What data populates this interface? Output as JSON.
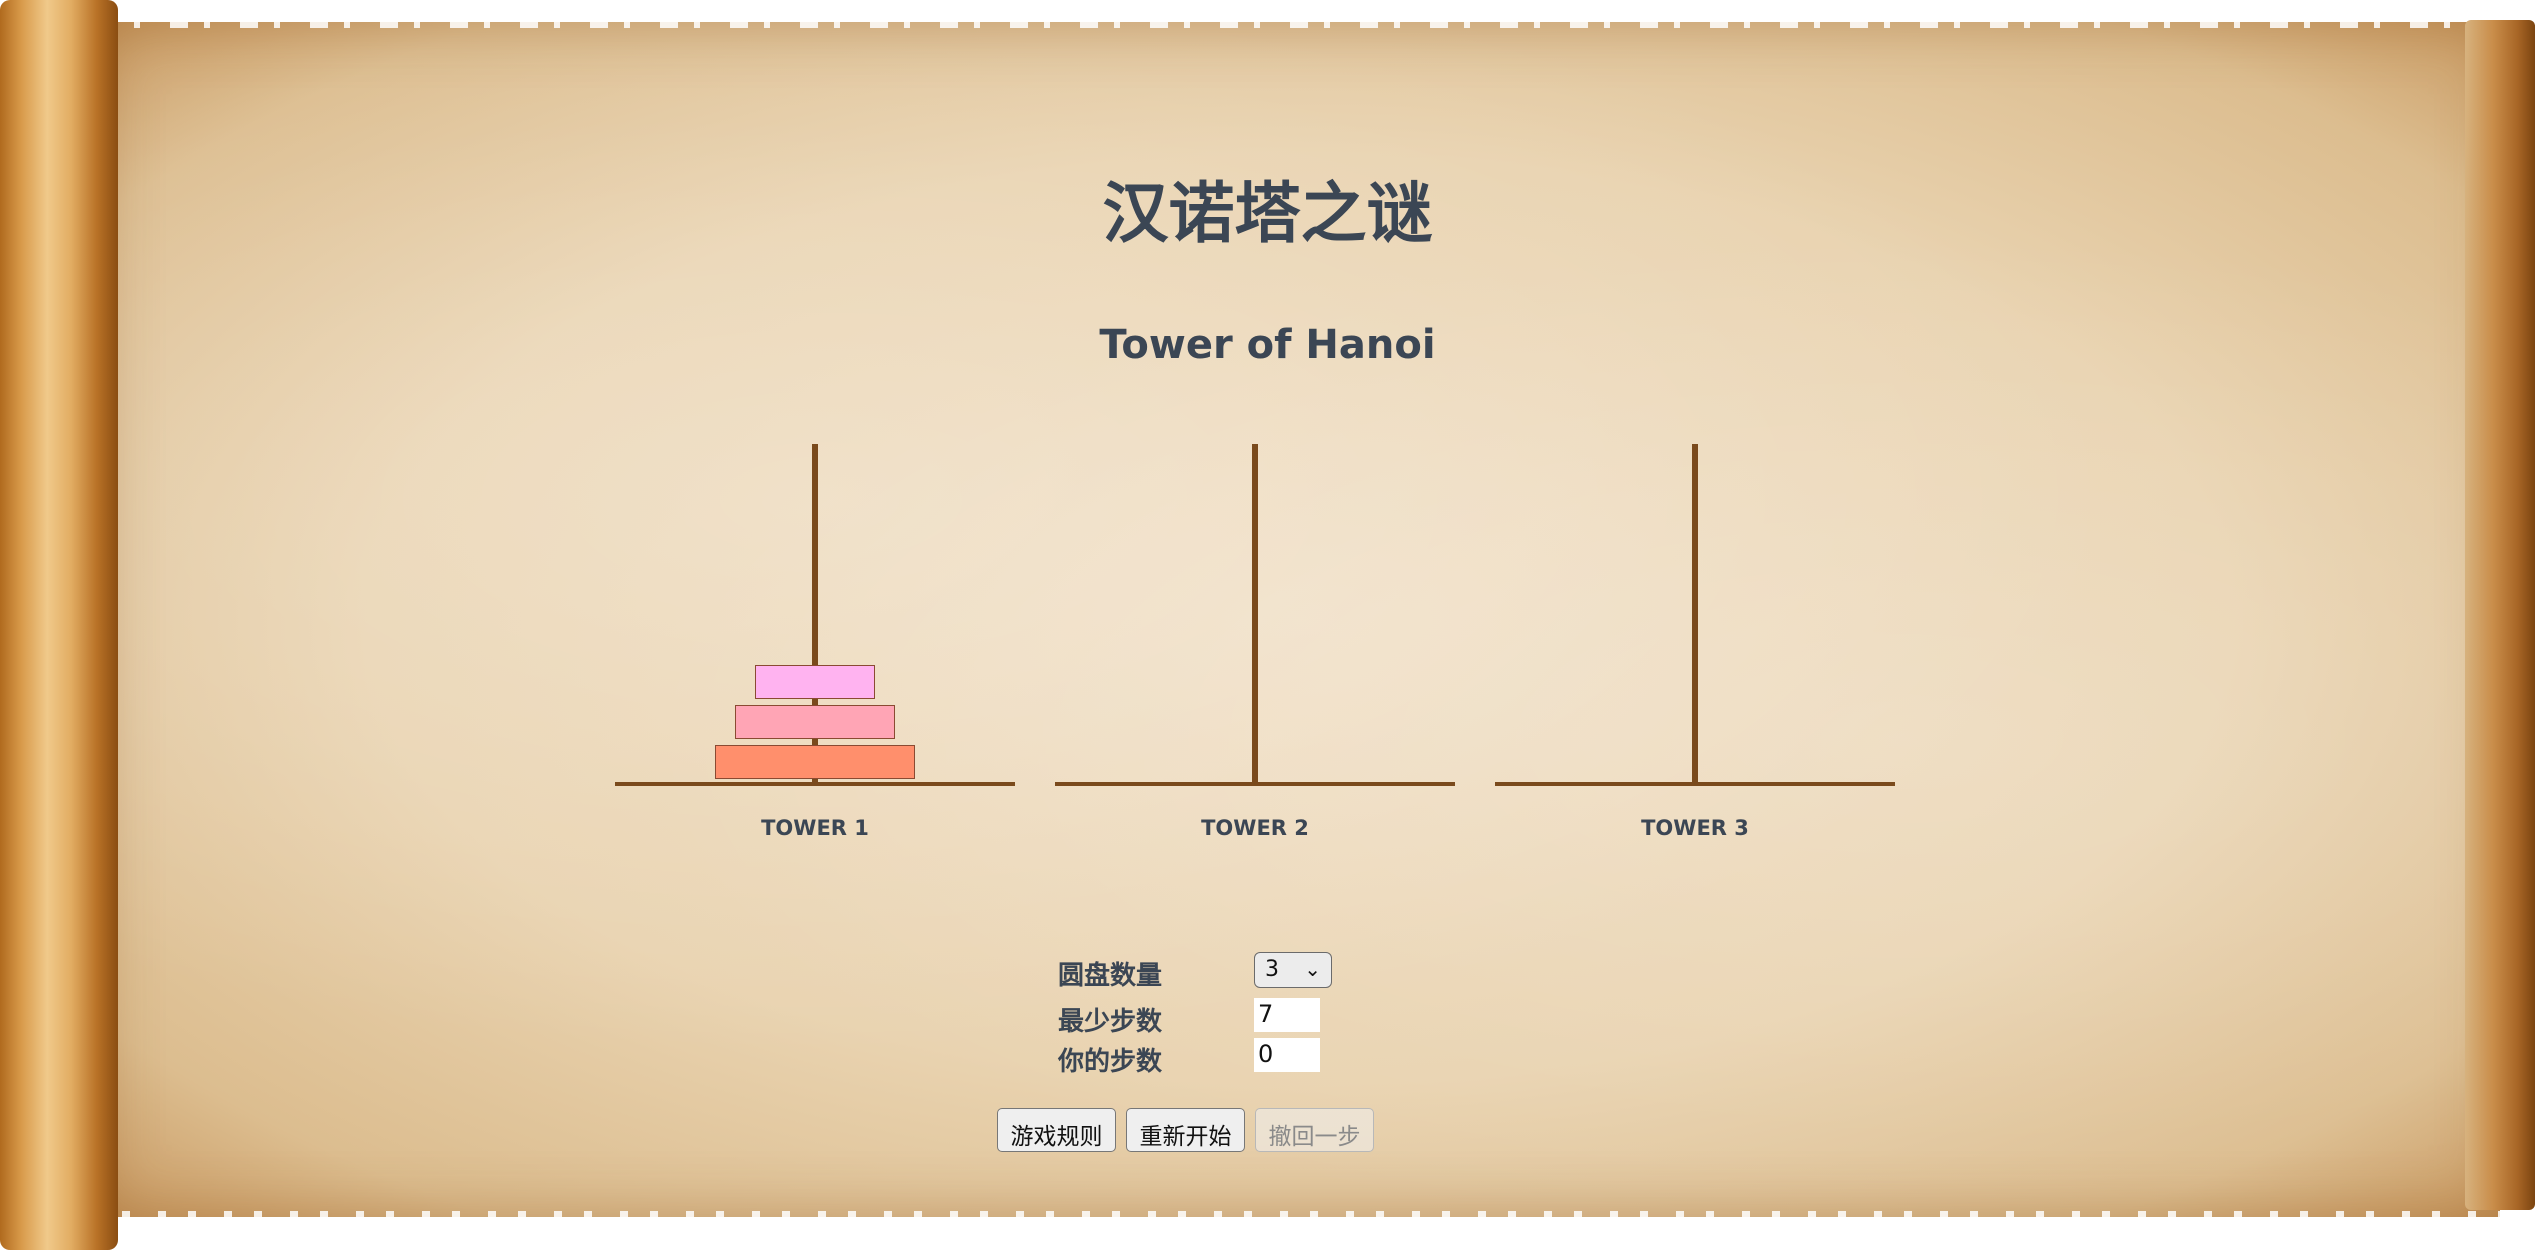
{
  "title": "汉诺塔之谜",
  "subtitle": "Tower of Hanoi",
  "towers": [
    {
      "label": "TOWER 1"
    },
    {
      "label": "TOWER 2"
    },
    {
      "label": "TOWER 3"
    }
  ],
  "disks": [
    {
      "size": 1,
      "tower": 1,
      "color": "#ffb3f0"
    },
    {
      "size": 2,
      "tower": 1,
      "color": "#ffa5b5"
    },
    {
      "size": 3,
      "tower": 1,
      "color": "#ff8f6c"
    }
  ],
  "colors": {
    "text": "#3b4654",
    "rod": "#7a4a1c"
  },
  "controls": {
    "disk_count_label": "圆盘数量",
    "disk_count_value": "3",
    "min_steps_label": "最少步数",
    "min_steps_value": "7",
    "your_steps_label": "你的步数",
    "your_steps_value": "0"
  },
  "buttons": {
    "rules": "游戏规则",
    "restart": "重新开始",
    "undo": "撤回一步"
  }
}
